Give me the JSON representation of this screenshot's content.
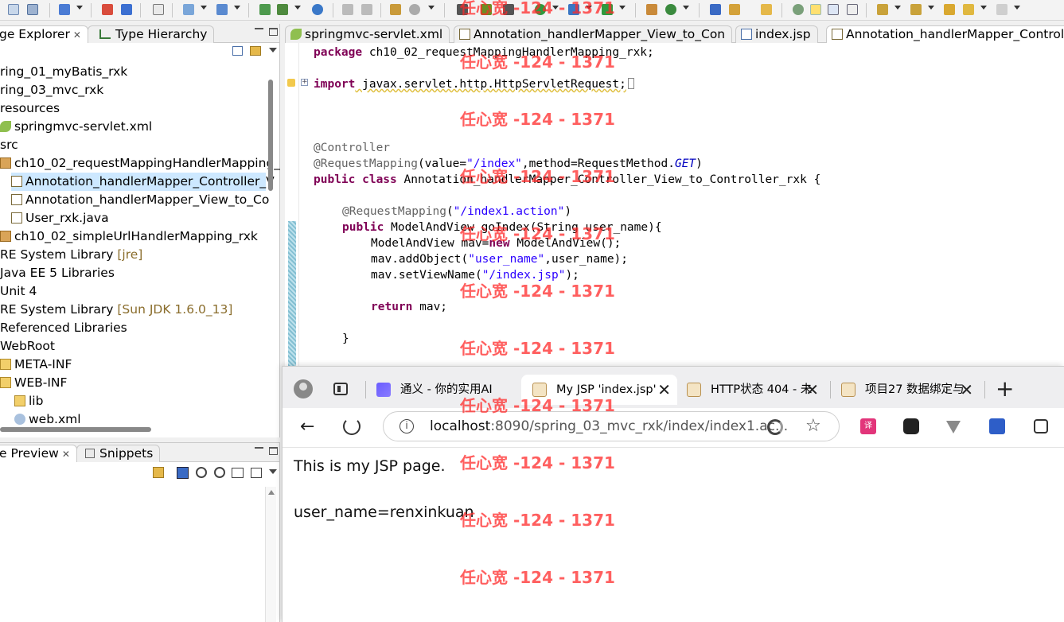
{
  "toolbar": {
    "icons": [
      "new-icon",
      "save-icon",
      "print-icon",
      "run-icon",
      "debug-icon",
      "search-icon",
      "back-icon",
      "forward-icon"
    ]
  },
  "explorer": {
    "tabs": [
      {
        "label": "ge Explorer",
        "close": "✕"
      },
      {
        "label": "Type Hierarchy"
      }
    ],
    "items": [
      {
        "label": "ring_01_myBatis_rxk"
      },
      {
        "label": "ring_03_mvc_rxk"
      },
      {
        "label": "resources"
      },
      {
        "label": "springmvc-servlet.xml"
      },
      {
        "label": "src"
      },
      {
        "label": "ch10_02_requestMappingHandlerMapping_"
      },
      {
        "label": "Annotation_handlerMapper_Controller_V"
      },
      {
        "label": "Annotation_handlerMapper_View_to_Co"
      },
      {
        "label": "User_rxk.java"
      },
      {
        "label": "ch10_02_simpleUrlHandlerMapping_rxk"
      },
      {
        "label": "RE System Library",
        "extra": "[jre]"
      },
      {
        "label": "Java EE 5 Libraries"
      },
      {
        "label": "Unit 4"
      },
      {
        "label": "RE System Library",
        "extra": "[Sun JDK 1.6.0_13]"
      },
      {
        "label": "Referenced Libraries"
      },
      {
        "label": "WebRoot"
      },
      {
        "label": "META-INF"
      },
      {
        "label": "WEB-INF"
      },
      {
        "label": "lib"
      },
      {
        "label": "web.xml"
      }
    ]
  },
  "preview": {
    "tabs": [
      {
        "label": "e Preview",
        "close": "✕"
      },
      {
        "label": "Snippets"
      }
    ]
  },
  "editor": {
    "tabs": [
      {
        "label": "springmvc-servlet.xml"
      },
      {
        "label": "Annotation_handlerMapper_View_to_Con"
      },
      {
        "label": "index.jsp"
      },
      {
        "label": "Annotation_handlerMapper_Controlle"
      }
    ],
    "code": {
      "package_kw": "package",
      "package_name": " ch10_02_requestMappingHandlerMapping_rxk;",
      "import_kw": "import",
      "import_name": " javax.servlet.http.HttpServletRequest;",
      "ann_controller": "@Controller",
      "ann_rm1": "@RequestMapping",
      "rm1_a": "(value=",
      "rm1_str": "\"/index\"",
      "rm1_b": ",method=RequestMethod.",
      "rm1_get": "GET",
      "rm1_c": ")",
      "public_kw": "public",
      "class_kw": " class",
      "class_name": " Annotation_handlerMapper_Controller_View_to_Controller_rxk {",
      "ann_rm2": "@RequestMapping",
      "rm2_a": "(",
      "rm2_str": "\"/index1.action\"",
      "rm2_c": ")",
      "method_sig": " ModelAndView goIndex(String user_name){",
      "mav_decl": "ModelAndView mav=",
      "new_kw": "new",
      "mav_ctor": " ModelAndView();",
      "add_a": "mav.addObject(",
      "add_str": "\"user_name\"",
      "add_b": ",user_name);",
      "set_a": "mav.setViewName(",
      "set_str": "\"/index.jsp\"",
      "set_b": ");",
      "return_kw": "return",
      "return_val": " mav;",
      "close_brace": "}"
    }
  },
  "browser": {
    "tabs": [
      {
        "label": "通义 - 你的实用AI"
      },
      {
        "label": "My JSP 'index.jsp'"
      },
      {
        "label": "HTTP状态 404 - 未"
      },
      {
        "label": "项目27 数据绑定与"
      }
    ],
    "close_glyph": "✕",
    "new_tab_glyph": "+",
    "url_host": "localhost",
    "url_rest": ":8090/spring_03_mvc_rxk/index/index1.ac...",
    "page_line1": "This is my JSP page.",
    "page_line2": "user_name=renxinkuan"
  },
  "watermark": {
    "text": "任心宽 -124 - 1371"
  },
  "colors": {
    "keyword": "#7f0055",
    "string": "#2a00ff",
    "annotation": "#646464",
    "watermark": "#ff2a2a"
  }
}
